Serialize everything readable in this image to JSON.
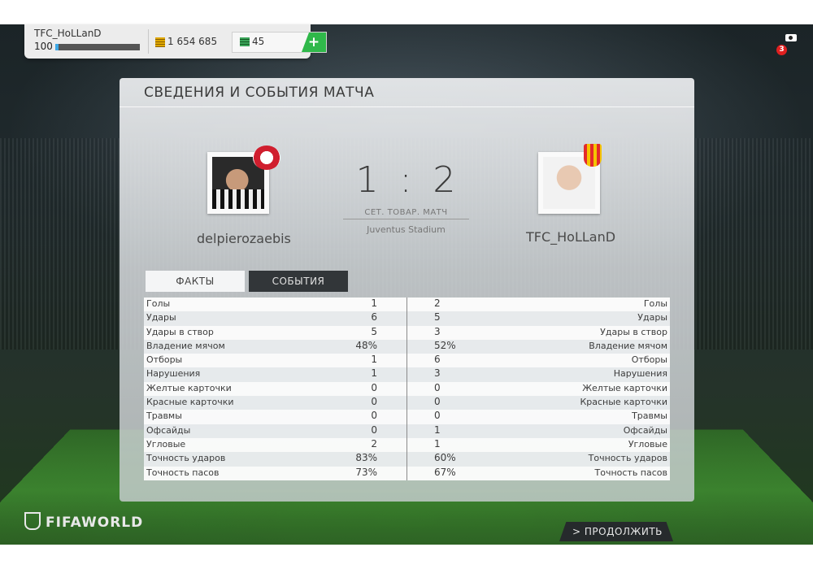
{
  "hud": {
    "username": "TFC_HoLLanD",
    "level": "100",
    "level_progress": 0.04,
    "coins": "1 654 685",
    "points": "45",
    "plus_label": "+",
    "notifications": "3"
  },
  "panel": {
    "title": "СВЕДЕНИЯ И СОБЫТИЯ МАТЧА",
    "home_name": "delpierozaebis",
    "away_name": "TFC_HoLLanD",
    "score": "1 : 2",
    "match_type": "СЕТ. ТОВАР. МАТЧ",
    "stadium": "Juventus Stadium"
  },
  "tabs": [
    {
      "label": "ФАКТЫ"
    },
    {
      "label": "СОБЫТИЯ"
    }
  ],
  "stats": [
    {
      "label": "Голы",
      "home": "1",
      "away": "2"
    },
    {
      "label": "Удары",
      "home": "6",
      "away": "5"
    },
    {
      "label": "Удары в створ",
      "home": "5",
      "away": "3"
    },
    {
      "label": "Владение мячом",
      "home": "48%",
      "away": "52%"
    },
    {
      "label": "Отборы",
      "home": "1",
      "away": "6"
    },
    {
      "label": "Нарушения",
      "home": "1",
      "away": "3"
    },
    {
      "label": "Желтые карточки",
      "home": "0",
      "away": "0"
    },
    {
      "label": "Красные карточки",
      "home": "0",
      "away": "0"
    },
    {
      "label": "Травмы",
      "home": "0",
      "away": "0"
    },
    {
      "label": "Офсайды",
      "home": "0",
      "away": "1"
    },
    {
      "label": "Угловые",
      "home": "2",
      "away": "1"
    },
    {
      "label": "Точность ударов",
      "home": "83%",
      "away": "60%"
    },
    {
      "label": "Точность пасов",
      "home": "73%",
      "away": "67%"
    }
  ],
  "footer": {
    "logo": "FIFAWORLD",
    "continue_label": "> ПРОДОЛЖИТЬ"
  },
  "colors": {
    "accent_green": "#2fb84a",
    "notification_red": "#e02020",
    "progress_blue": "#3da8e6"
  }
}
